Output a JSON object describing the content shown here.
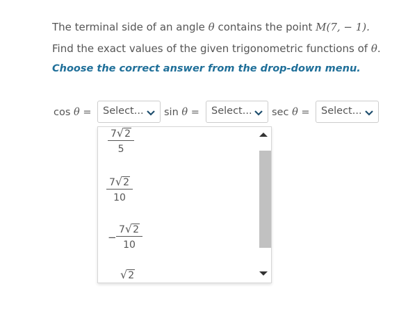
{
  "prompt": {
    "line1_a": "The terminal side of an angle ",
    "theta": "θ",
    "line1_b": " contains the point ",
    "point": "M(7, − 1).",
    "line2_a": "Find the exact values of the given trigonometric functions of ",
    "line2_b": "."
  },
  "instruction": "Choose the correct answer from the drop-down menu.",
  "questions": [
    {
      "func": "cos ",
      "theta": "θ",
      "eq": " =",
      "placeholder": "Select..."
    },
    {
      "func": "sin ",
      "theta": "θ",
      "eq": " =",
      "placeholder": "Select..."
    },
    {
      "func": "sec ",
      "theta": "θ",
      "eq": " =",
      "placeholder": "Select..."
    }
  ],
  "dropdown": {
    "options": [
      {
        "sign": "",
        "coef": "7",
        "radicand": "2",
        "den": "5"
      },
      {
        "sign": "",
        "coef": "7",
        "radicand": "2",
        "den": "10"
      },
      {
        "sign": "−",
        "coef": "7",
        "radicand": "2",
        "den": "10"
      },
      {
        "sign": "",
        "coef": "",
        "radicand": "2",
        "den": ""
      }
    ],
    "radical_symbol": "√"
  },
  "icons": {
    "chevron": "chevron-down-icon",
    "scroll_up": "arrow-up-icon",
    "scroll_down": "arrow-down-icon"
  },
  "colors": {
    "instruction": "#1f6f99",
    "text": "#555555",
    "border": "#cccccc",
    "scroll_thumb": "#c1c1c1"
  }
}
